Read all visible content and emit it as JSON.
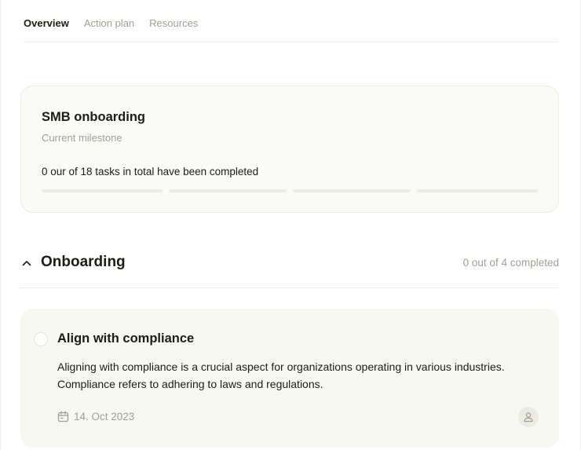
{
  "tabs": [
    {
      "label": "Overview",
      "active": true
    },
    {
      "label": "Action plan",
      "active": false
    },
    {
      "label": "Resources",
      "active": false
    }
  ],
  "milestone": {
    "title": "SMB onboarding",
    "subtitle": "Current milestone",
    "progress_text": "0 our of 18 tasks in total have been completed",
    "completed": 0,
    "total": 18,
    "segments": 4
  },
  "section": {
    "title": "Onboarding",
    "count_text": "0 out of 4 completed",
    "expanded": true,
    "icon": "chevron-up-icon"
  },
  "task": {
    "title": "Align with compliance",
    "description": "Aligning with compliance is a crucial aspect for organizations operating in various industries. Compliance refers to adhering to laws and regulations.",
    "date": "14. Oct 2023",
    "completed": false,
    "date_icon": "calendar-icon",
    "assignee_icon": "user-icon"
  },
  "colors": {
    "text": "#1d1c16",
    "muted": "#a19f95",
    "card_bg": "#fafaf6",
    "task_bg": "#f8f8f2",
    "progress_track": "#ecece3"
  }
}
